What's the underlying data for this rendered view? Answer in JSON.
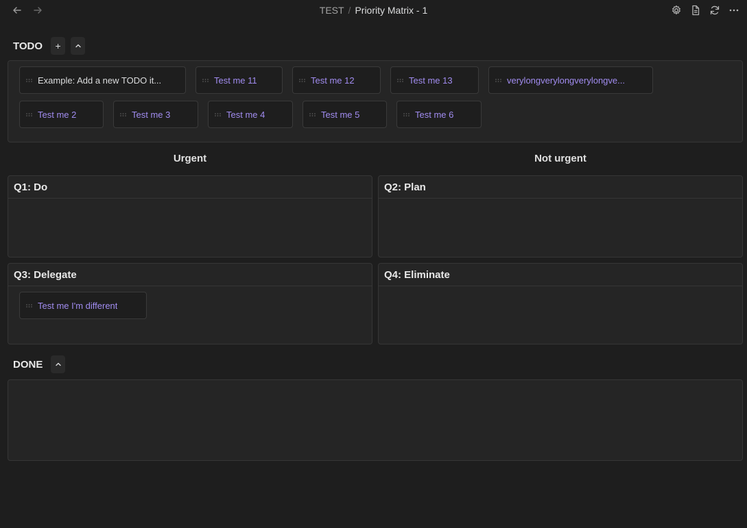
{
  "breadcrumb": {
    "folder": "TEST",
    "separator": "/",
    "file": "Priority Matrix - 1"
  },
  "todo": {
    "title": "TODO",
    "add_label": "+",
    "collapse_label": "^",
    "items": [
      {
        "label": "Example: Add a new TODO it..."
      },
      {
        "label": "Test me 11"
      },
      {
        "label": "Test me 12"
      },
      {
        "label": "Test me 13"
      },
      {
        "label": "verylongverylongverylongve..."
      },
      {
        "label": "Test me 2"
      },
      {
        "label": "Test me 3"
      },
      {
        "label": "Test me 4"
      },
      {
        "label": "Test me 5"
      },
      {
        "label": "Test me 6"
      }
    ]
  },
  "columns": {
    "urgent": "Urgent",
    "not_urgent": "Not urgent"
  },
  "quadrants": {
    "q1": {
      "title": "Q1: Do"
    },
    "q2": {
      "title": "Q2: Plan"
    },
    "q3": {
      "title": "Q3: Delegate",
      "items": [
        {
          "label": "Test me I'm different"
        }
      ]
    },
    "q4": {
      "title": "Q4: Eliminate"
    }
  },
  "done": {
    "title": "DONE",
    "collapse_label": "^"
  },
  "colors": {
    "accent": "#a18cf0",
    "background": "#1e1e1e",
    "panel": "#252525"
  },
  "icons": {
    "back": "arrow-left-icon",
    "forward": "arrow-right-icon",
    "settings": "gear-icon",
    "reading": "document-icon",
    "refresh": "refresh-icon",
    "more": "more-icon",
    "grip": "drag-handle-icon"
  }
}
